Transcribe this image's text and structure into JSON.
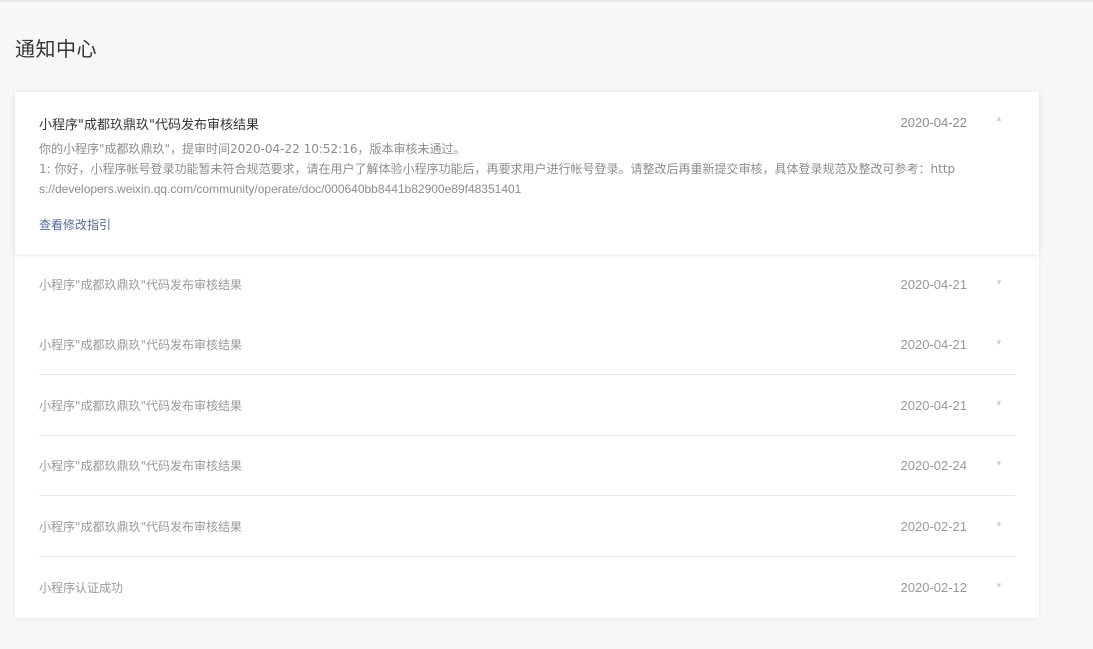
{
  "page": {
    "title": "通知中心"
  },
  "expanded": {
    "title": "小程序\"成都玖鼎玖\"代码发布审核结果",
    "date": "2020-04-22",
    "line1": "你的小程序\"成都玖鼎玖\"，提审时间2020-04-22 10:52:16，版本审核未通过。",
    "line2": "1: 你好，小程序帐号登录功能暂未符合规范要求，请在用户了解体验小程序功能后，再要求用户进行帐号登录。请整改后再重新提交审核，具体登录规范及整改可参考：http",
    "line3": "s://developers.weixin.qq.com/community/operate/doc/000640bb8441b82900e89f48351401",
    "link": "查看修改指引"
  },
  "notifications": [
    {
      "title": "小程序\"成都玖鼎玖\"代码发布审核结果",
      "date": "2020-04-21"
    },
    {
      "title": "小程序\"成都玖鼎玖\"代码发布审核结果",
      "date": "2020-04-21"
    },
    {
      "title": "小程序\"成都玖鼎玖\"代码发布审核结果",
      "date": "2020-04-21"
    },
    {
      "title": "小程序\"成都玖鼎玖\"代码发布审核结果",
      "date": "2020-02-24"
    },
    {
      "title": "小程序\"成都玖鼎玖\"代码发布审核结果",
      "date": "2020-02-21"
    },
    {
      "title": "小程序认证成功",
      "date": "2020-02-12"
    }
  ],
  "icons": {
    "caret": "chevron-down-icon"
  },
  "colors": {
    "link": "#576b95",
    "background": "#f6f7f9",
    "divider": "#e7e7eb"
  }
}
